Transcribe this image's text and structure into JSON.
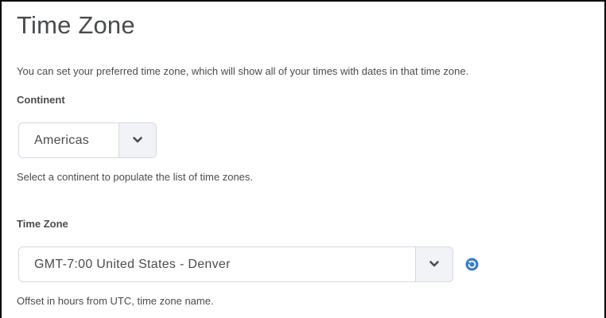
{
  "page": {
    "title": "Time Zone",
    "description": "You can set your preferred time zone, which will show all of your times with dates in that time zone."
  },
  "continent": {
    "label": "Continent",
    "selected": "Americas",
    "help": "Select a continent to populate the list of time zones."
  },
  "timezone": {
    "label": "Time Zone",
    "selected": "GMT-7:00 United States - Denver",
    "help": "Offset in hours from UTC, time zone name."
  },
  "icons": {
    "select_arrow": "chevron-down-icon",
    "reset": "reset-timezone-icon"
  },
  "colors": {
    "text": "#494c4e",
    "select_border": "#d3d9e3",
    "select_arrow_bg": "#f1f3f6",
    "accent": "#3a7fc1"
  }
}
